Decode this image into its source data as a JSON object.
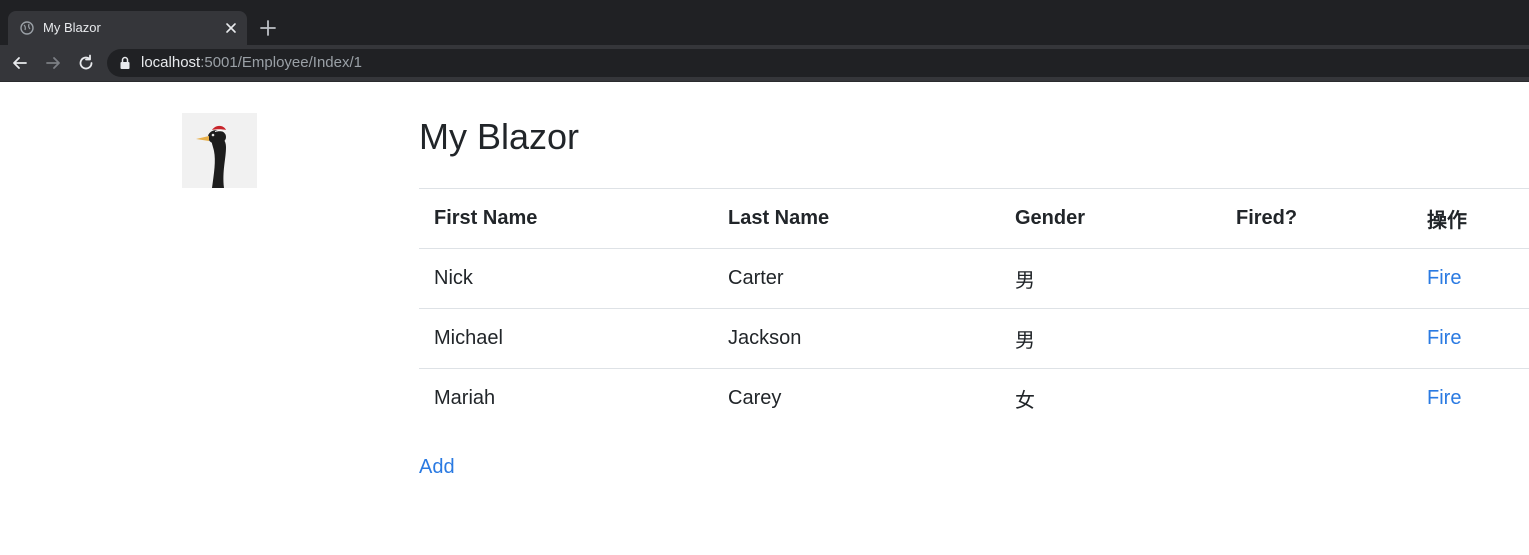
{
  "browser": {
    "tab": {
      "title": "My Blazor",
      "favicon": "globe-icon"
    },
    "address_bar": {
      "host": "localhost",
      "rest": ":5001/Employee/Index/1"
    },
    "colors": {
      "chrome_dark": "#202124",
      "chrome_toolbar": "#35363a"
    }
  },
  "page": {
    "logo": "bird-logo",
    "title": "My Blazor",
    "table": {
      "headers": {
        "first_name": "First Name",
        "last_name": "Last Name",
        "gender": "Gender",
        "fired": "Fired?",
        "actions": "操作"
      },
      "rows": [
        {
          "first_name": "Nick",
          "last_name": "Carter",
          "gender": "男",
          "fired": "",
          "action": "Fire"
        },
        {
          "first_name": "Michael",
          "last_name": "Jackson",
          "gender": "男",
          "fired": "",
          "action": "Fire"
        },
        {
          "first_name": "Mariah",
          "last_name": "Carey",
          "gender": "女",
          "fired": "",
          "action": "Fire"
        }
      ]
    },
    "add_label": "Add",
    "colors": {
      "link": "#2a7ae2",
      "text": "#212529",
      "border": "#dee2e6"
    }
  }
}
